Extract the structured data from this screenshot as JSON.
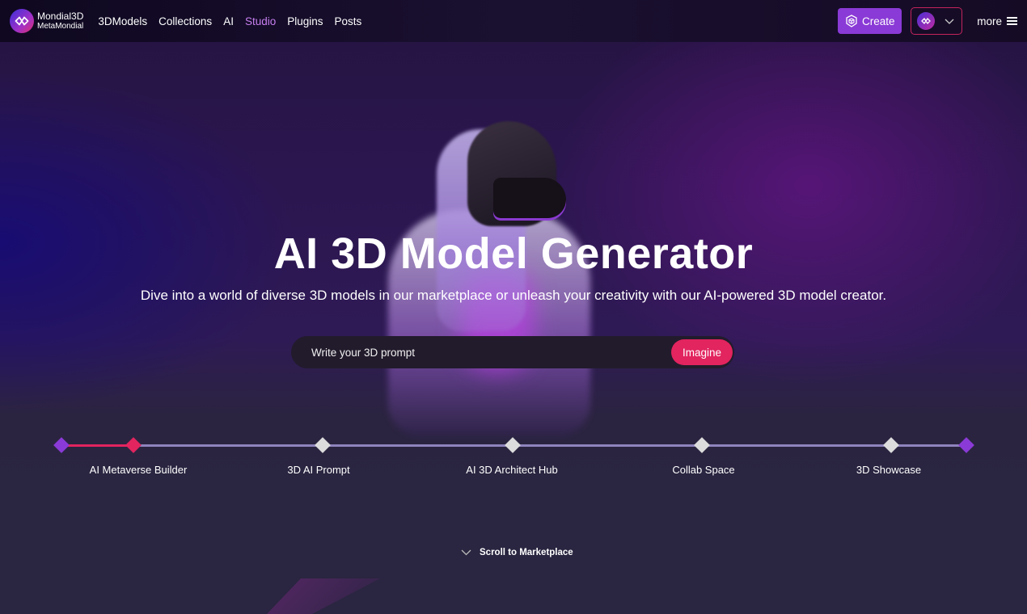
{
  "brand": {
    "name": "Mondial3D",
    "sub": "MetaMondial",
    "colors": {
      "accent_purple": "#8a3ad6",
      "accent_pink": "#e2245f",
      "active_link": "#c77ff0"
    }
  },
  "nav": {
    "links": [
      {
        "label": "3DModels",
        "active": false
      },
      {
        "label": "Collections",
        "active": false
      },
      {
        "label": "AI",
        "active": false
      },
      {
        "label": "Studio",
        "active": true
      },
      {
        "label": "Plugins",
        "active": false
      },
      {
        "label": "Posts",
        "active": false
      }
    ],
    "create_label": "Create",
    "create_icon": "cube-shield-icon",
    "account_icon": "mondial-logo-icon",
    "account_chevron": "chevron-down-icon",
    "more_label": "more",
    "more_icon": "hamburger-icon"
  },
  "hero": {
    "title": "AI 3D Model Generator",
    "subtitle": "Dive into a world of diverse 3D models in our marketplace or unleash your creativity with our AI-powered 3D model creator.",
    "prompt_placeholder": "Write your 3D prompt",
    "prompt_value": "",
    "imagine_label": "Imagine"
  },
  "stepper": {
    "active_index": 0,
    "steps": [
      {
        "label": "AI Metaverse Builder"
      },
      {
        "label": "3D AI Prompt"
      },
      {
        "label": "AI 3D Architect Hub"
      },
      {
        "label": "Collab Space"
      },
      {
        "label": "3D Showcase"
      }
    ]
  },
  "scroll_hint": {
    "label": "Scroll to Marketplace",
    "icon": "chevron-down-icon"
  }
}
